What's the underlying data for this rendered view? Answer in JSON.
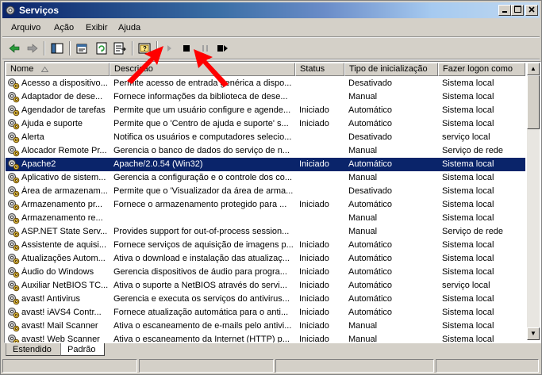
{
  "window": {
    "title": "Serviços"
  },
  "menu": [
    "Arquivo",
    "Ação",
    "Exibir",
    "Ajuda"
  ],
  "toolbar": {
    "icons": [
      "back-icon",
      "forward-icon",
      "show-hide-tree-icon",
      "properties-icon",
      "refresh-icon",
      "export-list-icon",
      "help-icon",
      "start-service-icon",
      "stop-service-icon",
      "pause-service-icon",
      "restart-service-icon"
    ]
  },
  "columns": [
    "Nome",
    "Descrição",
    "Status",
    "Tipo de inicialização",
    "Fazer logon como"
  ],
  "rows": [
    [
      "Acesso a dispositivo...",
      "Permite acesso de entrada genérica a dispo...",
      "",
      "Desativado",
      "Sistema local"
    ],
    [
      "Adaptador de dese...",
      "Fornece informações da biblioteca de dese...",
      "",
      "Manual",
      "Sistema local"
    ],
    [
      "Agendador de tarefas",
      "Permite que um usuário configure e agende...",
      "Iniciado",
      "Automático",
      "Sistema local"
    ],
    [
      "Ajuda e suporte",
      "Permite que o 'Centro de ajuda e suporte' s...",
      "Iniciado",
      "Automático",
      "Sistema local"
    ],
    [
      "Alerta",
      "Notifica os usuários e computadores selecio...",
      "",
      "Desativado",
      "serviço local"
    ],
    [
      "Alocador Remote Pr...",
      "Gerencia o banco de dados do serviço de n...",
      "",
      "Manual",
      "Serviço de rede"
    ],
    [
      "Apache2",
      "Apache/2.0.54 (Win32)",
      "Iniciado",
      "Automático",
      "Sistema local"
    ],
    [
      "Aplicativo de sistem...",
      "Gerencia a configuração e o controle dos co...",
      "",
      "Manual",
      "Sistema local"
    ],
    [
      "Área de armazenam...",
      "Permite que o 'Visualizador da área de arma...",
      "",
      "Desativado",
      "Sistema local"
    ],
    [
      "Armazenamento pr...",
      "Fornece o armazenamento protegido para ...",
      "Iniciado",
      "Automático",
      "Sistema local"
    ],
    [
      "Armazenamento re...",
      "",
      "",
      "Manual",
      "Sistema local"
    ],
    [
      "ASP.NET State Serv...",
      "Provides support for out-of-process session...",
      "",
      "Manual",
      "Serviço de rede"
    ],
    [
      "Assistente de aquisi...",
      "Fornece serviços de aquisição de imagens p...",
      "Iniciado",
      "Automático",
      "Sistema local"
    ],
    [
      "Atualizações Autom...",
      "Ativa o download e instalação das atualizaç...",
      "Iniciado",
      "Automático",
      "Sistema local"
    ],
    [
      "Áudio do Windows",
      "Gerencia dispositivos de áudio para progra...",
      "Iniciado",
      "Automático",
      "Sistema local"
    ],
    [
      "Auxiliar NetBIOS TC...",
      "Ativa o suporte a NetBIOS através do servi...",
      "Iniciado",
      "Automático",
      "serviço local"
    ],
    [
      "avast! Antivirus",
      "Gerencia e executa os serviços do antivirus...",
      "Iniciado",
      "Automático",
      "Sistema local"
    ],
    [
      "avast! iAVS4 Contr...",
      "Fornece atualização automática para o anti...",
      "Iniciado",
      "Automático",
      "Sistema local"
    ],
    [
      "avast! Mail Scanner",
      "Ativa o escaneamento de e-mails pelo antivi...",
      "Iniciado",
      "Manual",
      "Sistema local"
    ],
    [
      "avast! Web Scanner",
      "Ativa o escaneamento da Internet (HTTP) p...",
      "Iniciado",
      "Manual",
      "Sistema local"
    ]
  ],
  "selected_row": 6,
  "tabs": [
    "Estendido",
    "Padrão"
  ],
  "active_tab": 1
}
